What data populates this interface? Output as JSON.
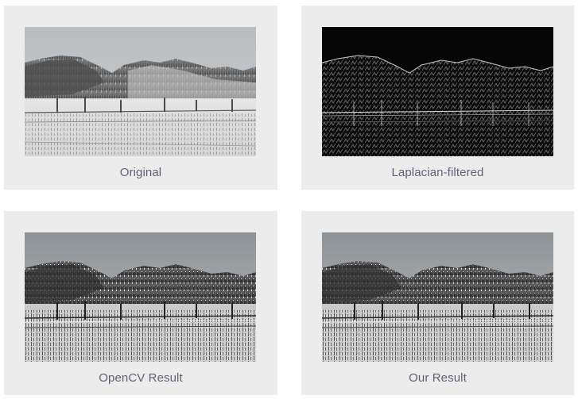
{
  "panels": [
    {
      "caption": "Original"
    },
    {
      "caption": "Laplacian-filtered"
    },
    {
      "caption": "OpenCV Result"
    },
    {
      "caption": "Our Result"
    }
  ]
}
